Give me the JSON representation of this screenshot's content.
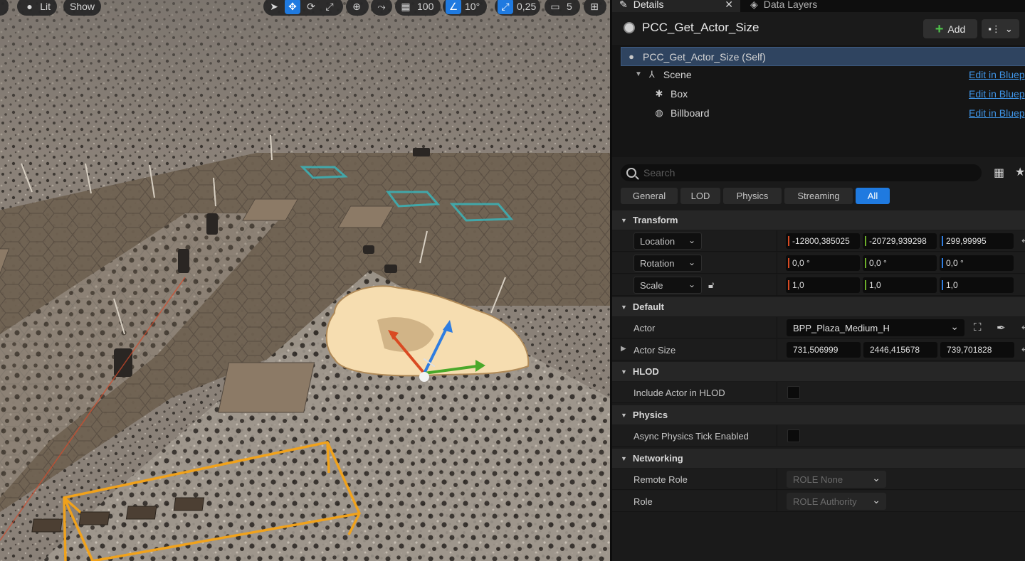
{
  "viewport": {
    "toolbar": {
      "lit_label": "Lit",
      "show_label": "Show",
      "grid_snap_value": "100",
      "rotation_snap_value": "10°",
      "scale_snap_value": "0,25",
      "camera_speed_value": "5"
    }
  },
  "details": {
    "tabs": {
      "details": "Details",
      "data_layers": "Data Layers"
    },
    "actor_title": "PCC_Get_Actor_Size",
    "add_label": "Add",
    "components": [
      {
        "label": "PCC_Get_Actor_Size (Self)",
        "icon": "actor-icon"
      },
      {
        "label": "Scene",
        "icon": "scene-icon",
        "edit": "Edit in Bluep"
      },
      {
        "label": "Box",
        "icon": "box-icon",
        "edit": "Edit in Bluep"
      },
      {
        "label": "Billboard",
        "icon": "billboard-icon",
        "edit": "Edit in Bluep"
      }
    ],
    "search_placeholder": "Search",
    "filters": [
      "General",
      "LOD",
      "Physics",
      "Streaming",
      "All"
    ],
    "active_filter": "All",
    "sections": {
      "transform": "Transform",
      "default": "Default",
      "hlod": "HLOD",
      "physics": "Physics",
      "networking": "Networking"
    },
    "transform": {
      "location": {
        "label": "Location",
        "x": "-12800,385025",
        "y": "-20729,939298",
        "z": "299,99995"
      },
      "rotation": {
        "label": "Rotation",
        "x": "0,0 °",
        "y": "0,0 °",
        "z": "0,0 °"
      },
      "scale": {
        "label": "Scale",
        "x": "1,0",
        "y": "1,0",
        "z": "1,0"
      }
    },
    "default": {
      "actor": {
        "label": "Actor",
        "value": "BPP_Plaza_Medium_H"
      },
      "actor_size": {
        "label": "Actor Size",
        "x": "731,506999",
        "y": "2446,415678",
        "z": "739,701828"
      }
    },
    "hlod": {
      "include_label": "Include Actor in HLOD"
    },
    "physics": {
      "async_label": "Async Physics Tick Enabled"
    },
    "networking": {
      "remote_role": {
        "label": "Remote Role",
        "value": "ROLE None"
      },
      "role": {
        "label": "Role",
        "value": "ROLE Authority"
      }
    }
  },
  "colors": {
    "accent": "#1f7ae0",
    "axis_x": "#d94a22",
    "axis_y": "#6cae2a",
    "axis_z": "#2f7de0",
    "selection_box": "#f0a21c"
  }
}
